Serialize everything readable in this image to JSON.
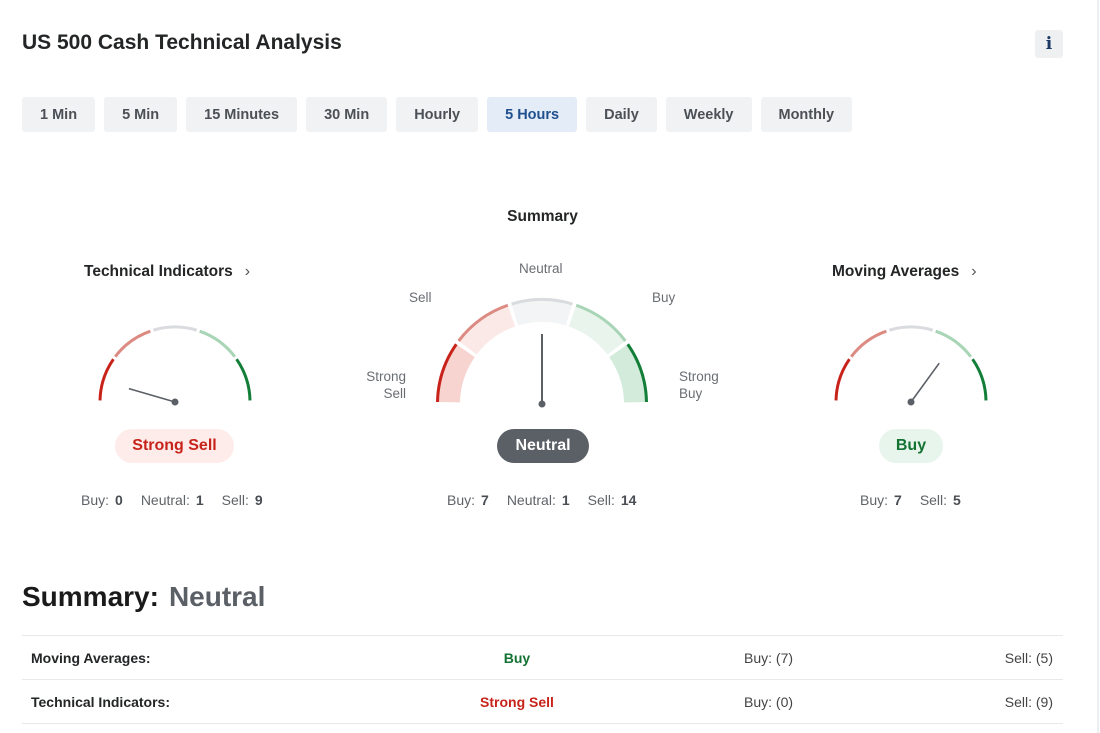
{
  "header": {
    "title": "US 500 Cash Technical Analysis",
    "info_label": "i"
  },
  "timeframes": {
    "items": [
      "1 Min",
      "5 Min",
      "15 Minutes",
      "30 Min",
      "Hourly",
      "5 Hours",
      "Daily",
      "Weekly",
      "Monthly"
    ],
    "selected": "5 Hours"
  },
  "summary_gauge": {
    "heading": "Summary",
    "labels": {
      "strong_sell": "Strong Sell",
      "sell": "Sell",
      "neutral": "Neutral",
      "buy": "Buy",
      "strong_buy": "Strong Buy"
    },
    "signal": "Neutral",
    "needle_level": 0.5,
    "counts": {
      "buy_label": "Buy:",
      "buy": "7",
      "neutral_label": "Neutral:",
      "neutral": "1",
      "sell_label": "Sell:",
      "sell": "14"
    }
  },
  "technical_indicators": {
    "title": "Technical Indicators",
    "signal": "Strong Sell",
    "needle_level": 0.09,
    "counts": {
      "buy_label": "Buy:",
      "buy": "0",
      "neutral_label": "Neutral:",
      "neutral": "1",
      "sell_label": "Sell:",
      "sell": "9"
    }
  },
  "moving_averages": {
    "title": "Moving Averages",
    "signal": "Buy",
    "needle_level": 0.7,
    "counts": {
      "buy_label": "Buy:",
      "buy": "7",
      "sell_label": "Sell:",
      "sell": "5"
    }
  },
  "summary": {
    "label": "Summary:",
    "value": "Neutral",
    "rows": [
      {
        "name": "Moving Averages:",
        "signal": "Buy",
        "buy": "Buy: (7)",
        "sell": "Sell: (5)"
      },
      {
        "name": "Technical Indicators:",
        "signal": "Strong Sell",
        "buy": "Buy: (0)",
        "sell": "Sell: (9)"
      }
    ]
  },
  "colors": {
    "strong_sell": "#c8231b",
    "sell": "#dc8a82",
    "neutral": "#d9dbde",
    "buy": "#a8d5b5",
    "strong_buy": "#137e38",
    "needle": "#5b5f66"
  }
}
